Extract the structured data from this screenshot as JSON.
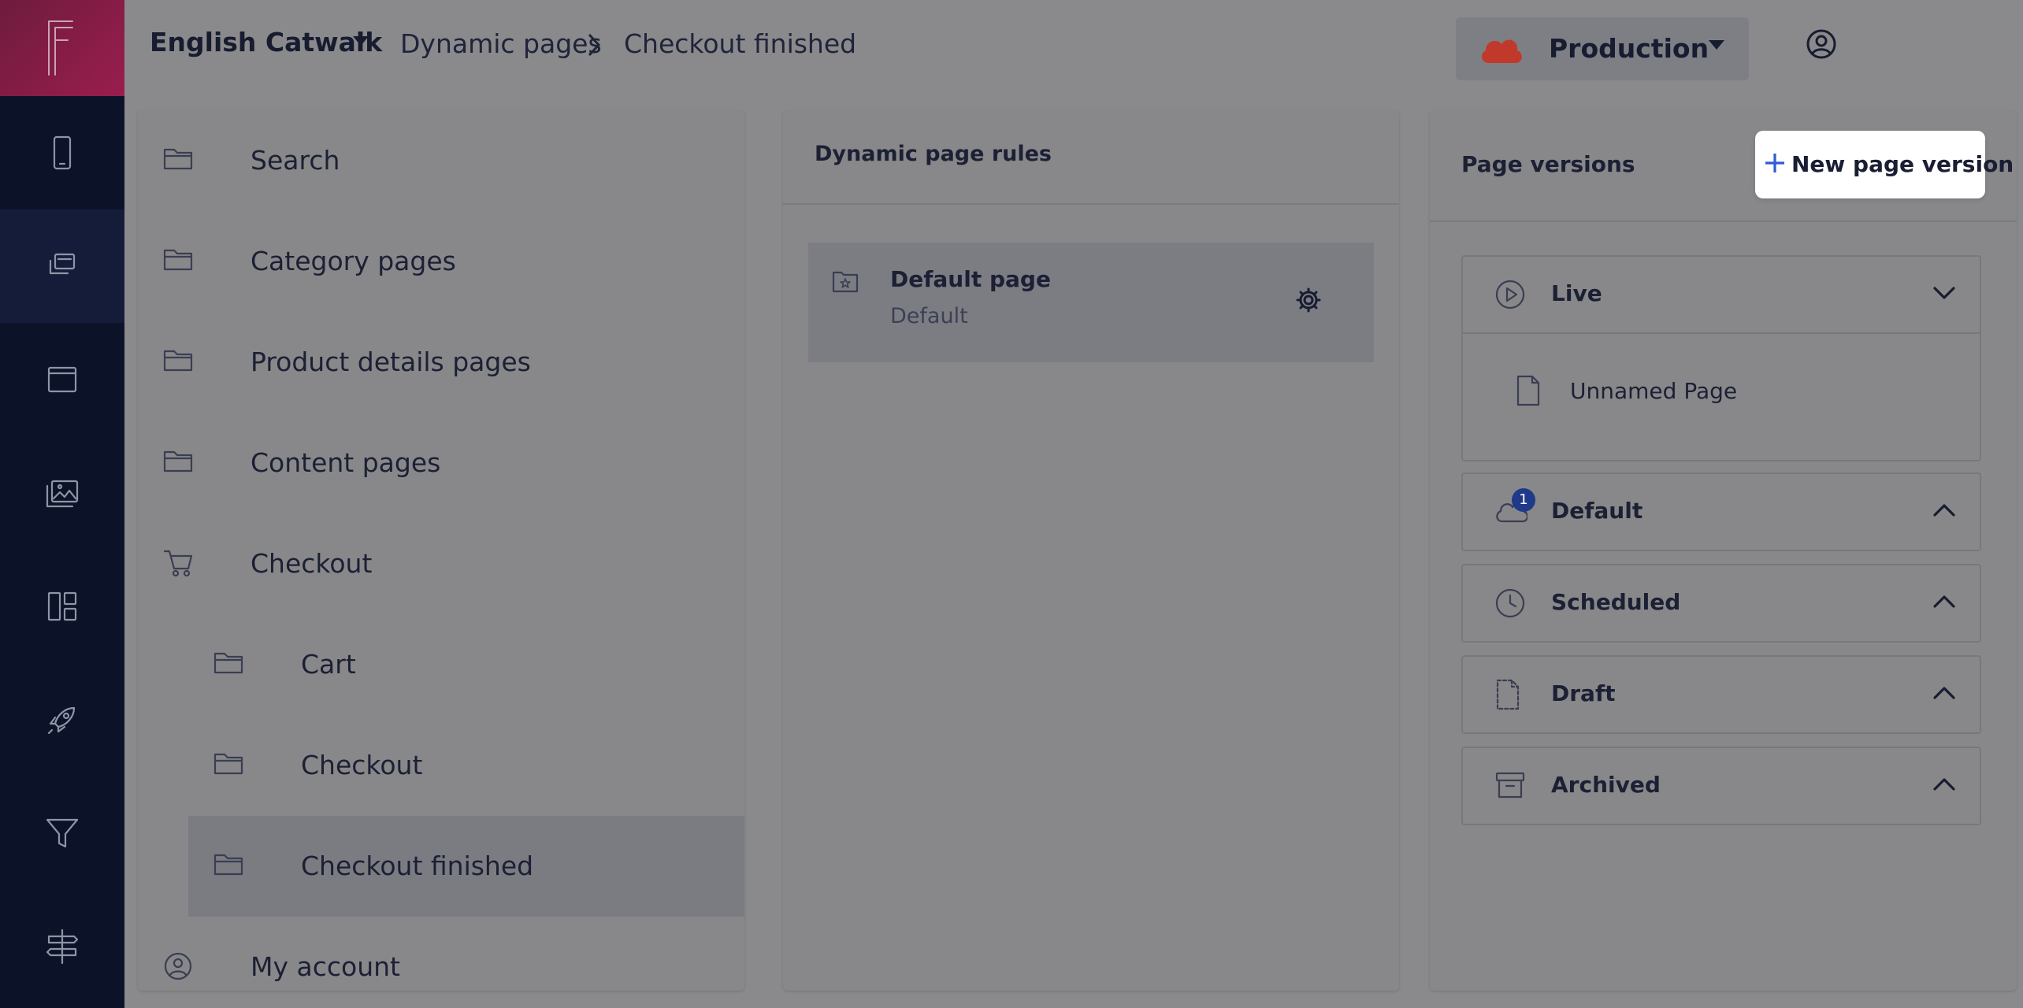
{
  "app": {
    "brand": "English Catwalk",
    "breadcrumb": [
      "Dynamic pages",
      "Checkout finished"
    ],
    "environment": "Production",
    "accent_color": "#9a1d4e",
    "env_cloud_color": "#c0392b"
  },
  "rail": {
    "icons": [
      "logo-icon",
      "mobile-icon",
      "pages-icon",
      "browser-window-icon",
      "media-gallery-icon",
      "layout-icon",
      "rocket-icon",
      "filter-icon",
      "signpost-icon"
    ]
  },
  "tree": {
    "items": [
      {
        "label": "Search",
        "icon": "folder-icon"
      },
      {
        "label": "Category pages",
        "icon": "folder-icon"
      },
      {
        "label": "Product details pages",
        "icon": "folder-icon"
      },
      {
        "label": "Content pages",
        "icon": "folder-icon"
      },
      {
        "label": "Checkout",
        "icon": "cart-icon"
      },
      {
        "label": "Cart",
        "icon": "folder-icon"
      },
      {
        "label": "Checkout",
        "icon": "folder-icon"
      },
      {
        "label": "Checkout finished",
        "icon": "folder-icon",
        "selected": true
      },
      {
        "label": "My account",
        "icon": "user-circle-icon"
      }
    ]
  },
  "rules": {
    "title": "Dynamic page rules",
    "card": {
      "title": "Default page",
      "subtitle": "Default"
    }
  },
  "versions": {
    "title": "Page versions",
    "new_button": "New page version",
    "groups": [
      {
        "label": "Live",
        "expanded": true,
        "pages": [
          "Unnamed Page"
        ]
      },
      {
        "label": "Default",
        "badge": "1",
        "expanded": false
      },
      {
        "label": "Scheduled",
        "expanded": false
      },
      {
        "label": "Draft",
        "expanded": false
      },
      {
        "label": "Archived",
        "expanded": false
      }
    ]
  }
}
